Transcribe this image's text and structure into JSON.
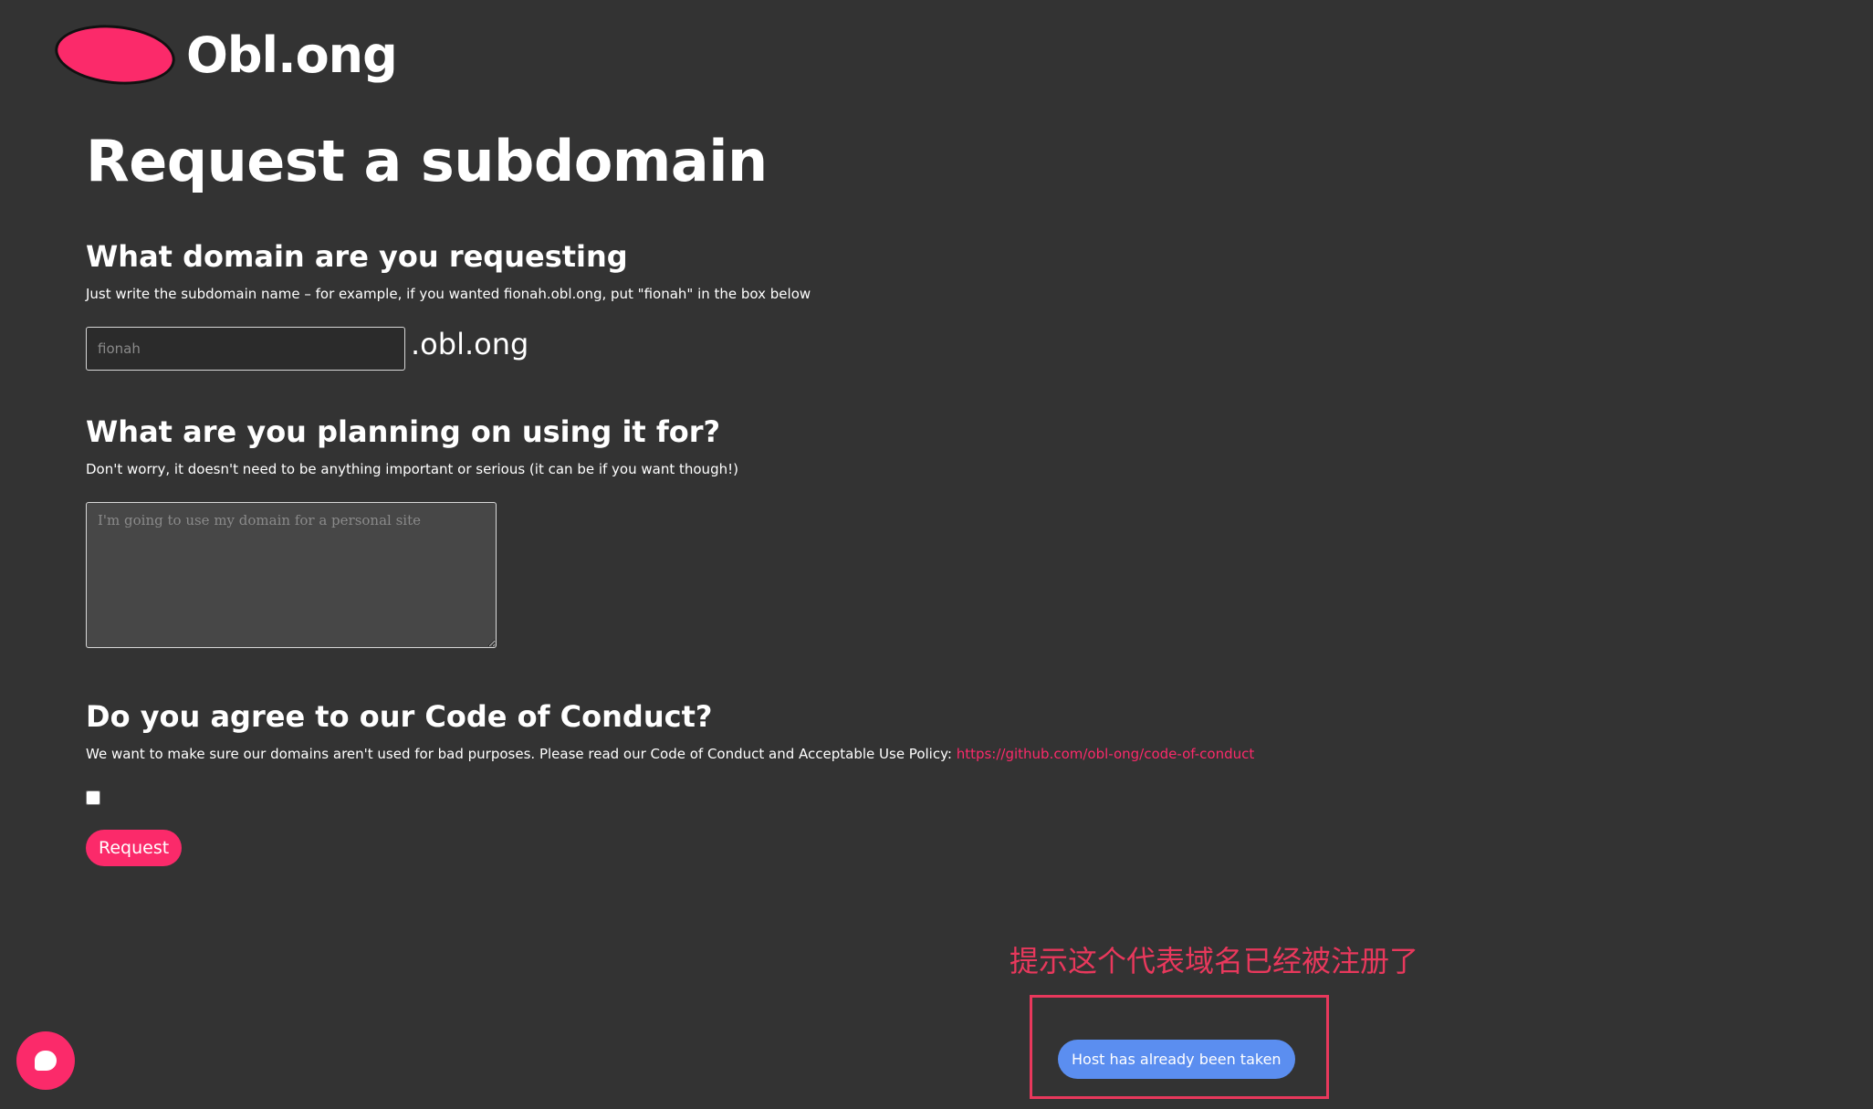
{
  "brand": {
    "name": "Obl.ong",
    "accent_color": "#fb2a6a"
  },
  "page": {
    "title": "Request a subdomain"
  },
  "domain_section": {
    "heading": "What domain are you requesting",
    "description": "Just write the subdomain name – for example, if you wanted fionah.obl.ong, put \"fionah\" in the box below",
    "input_value": "",
    "input_placeholder": "fionah",
    "suffix": ".obl.ong"
  },
  "purpose_section": {
    "heading": "What are you planning on using it for?",
    "description": "Don't worry, it doesn't need to be anything important or serious (it can be if you want though!)",
    "textarea_value": "",
    "textarea_placeholder": "I'm going to use my domain for a personal site"
  },
  "conduct_section": {
    "heading": "Do you agree to our Code of Conduct?",
    "description": "We want to make sure our domains aren't used for bad purposes. Please read our Code of Conduct and Acceptable Use Policy: ",
    "link_text": "https://github.com/obl-ong/code-of-conduct",
    "checkbox_checked": false
  },
  "actions": {
    "request_label": "Request"
  },
  "toast": {
    "message": "Host has already been taken",
    "color": "#5b8ef0"
  },
  "annotation": {
    "text": "提示这个代表域名已经被注册了",
    "color": "#e8385c"
  },
  "chat_widget": {
    "icon": "chat-bubble-icon"
  }
}
